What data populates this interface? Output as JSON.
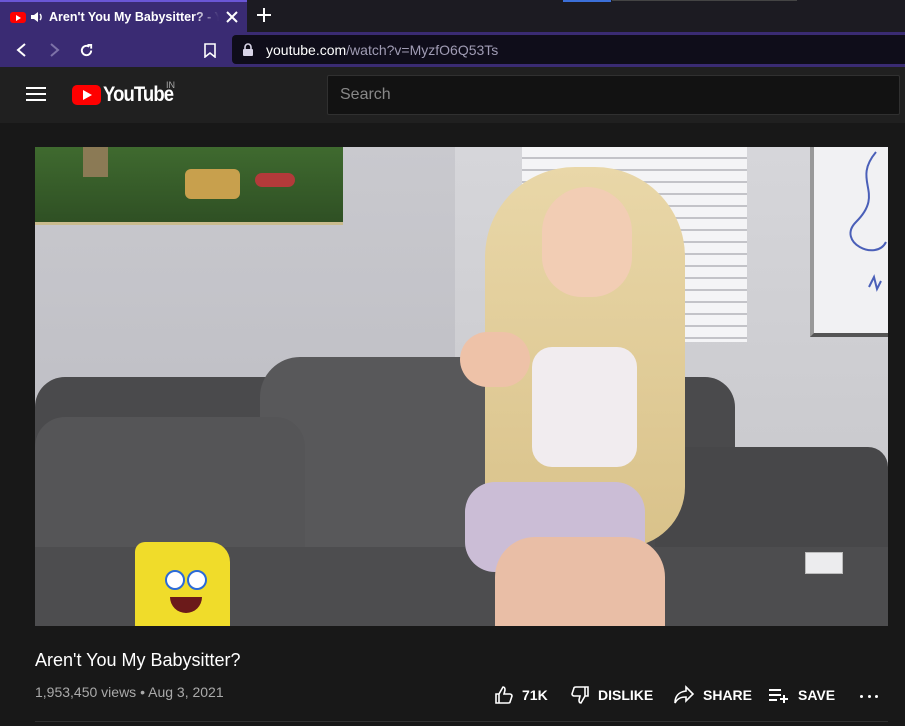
{
  "browser": {
    "tab_title": "Aren't You My Babysitter? - YouTube",
    "url_host": "youtube.com",
    "url_path": "/watch?v=MyzfO6Q53Ts",
    "accent_color": "#3a2b73"
  },
  "youtube": {
    "logo_text": "YouTube",
    "country_code": "IN",
    "search_placeholder": "Search"
  },
  "video": {
    "title": "Aren't You My Babysitter?",
    "views": "1,953,450 views",
    "date": "Aug 3, 2021",
    "meta_separator": " • "
  },
  "actions": {
    "like_count": "71K",
    "dislike_label": "DISLIKE",
    "share_label": "SHARE",
    "save_label": "SAVE"
  },
  "icons": [
    "youtube-favicon",
    "speaker-icon",
    "close-icon",
    "plus-icon",
    "back-icon",
    "forward-icon",
    "reload-icon",
    "bookmark-icon",
    "lock-icon",
    "menu-icon",
    "thumbs-up-icon",
    "thumbs-down-icon",
    "share-icon",
    "playlist-add-icon",
    "more-icon"
  ]
}
